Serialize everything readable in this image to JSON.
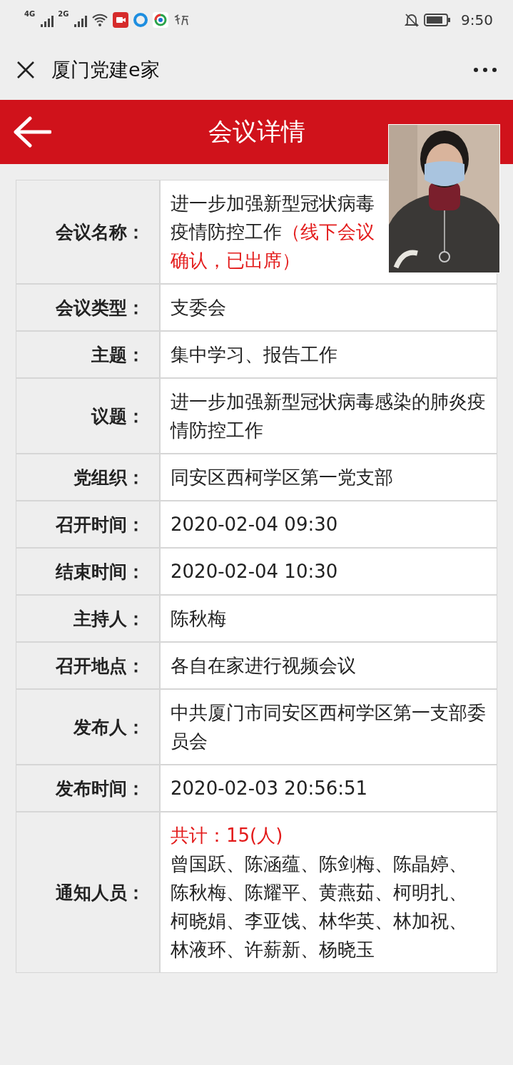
{
  "status_bar": {
    "networks": [
      "4G",
      "2G"
    ],
    "time": "9:50"
  },
  "app_bar": {
    "title": "厦门党建e家"
  },
  "header": {
    "title": "会议详情"
  },
  "rows": [
    {
      "label": "会议名称：",
      "parts": [
        {
          "text": "进一步加强新型冠状病毒疫情防控工作",
          "kind": "plain"
        },
        {
          "text": "（线下会议确认，已出席）",
          "kind": "note"
        }
      ]
    },
    {
      "label": "会议类型：",
      "parts": [
        {
          "text": "支委会",
          "kind": "plain"
        }
      ]
    },
    {
      "label": "主题：",
      "parts": [
        {
          "text": "集中学习、报告工作",
          "kind": "plain"
        }
      ]
    },
    {
      "label": "议题：",
      "parts": [
        {
          "text": "进一步加强新型冠状病毒感染的肺炎疫情防控工作",
          "kind": "plain"
        }
      ]
    },
    {
      "label": "党组织：",
      "parts": [
        {
          "text": "同安区西柯学区第一党支部",
          "kind": "plain"
        }
      ]
    },
    {
      "label": "召开时间：",
      "parts": [
        {
          "text": "2020-02-04 09:30",
          "kind": "plain"
        }
      ]
    },
    {
      "label": "结束时间：",
      "parts": [
        {
          "text": "2020-02-04 10:30",
          "kind": "plain"
        }
      ]
    },
    {
      "label": "主持人：",
      "parts": [
        {
          "text": "陈秋梅",
          "kind": "plain"
        }
      ]
    },
    {
      "label": "召开地点：",
      "parts": [
        {
          "text": "各自在家进行视频会议",
          "kind": "plain"
        }
      ]
    },
    {
      "label": "发布人：",
      "parts": [
        {
          "text": "中共厦门市同安区西柯学区第一支部委员会",
          "kind": "plain"
        }
      ]
    },
    {
      "label": "发布时间：",
      "parts": [
        {
          "text": "2020-02-03 20:56:51",
          "kind": "plain"
        }
      ]
    },
    {
      "label": "通知人员：",
      "parts": [
        {
          "text": "共计：15(人)",
          "kind": "note_line"
        },
        {
          "text": "曾国跃、陈涵蕴、陈剑梅、陈晶婷、陈秋梅、陈耀平、黄燕茹、柯明扎、柯晓娟、李亚饯、林华英、林加祝、林液环、许薪新、杨晓玉",
          "kind": "plain"
        }
      ]
    }
  ]
}
